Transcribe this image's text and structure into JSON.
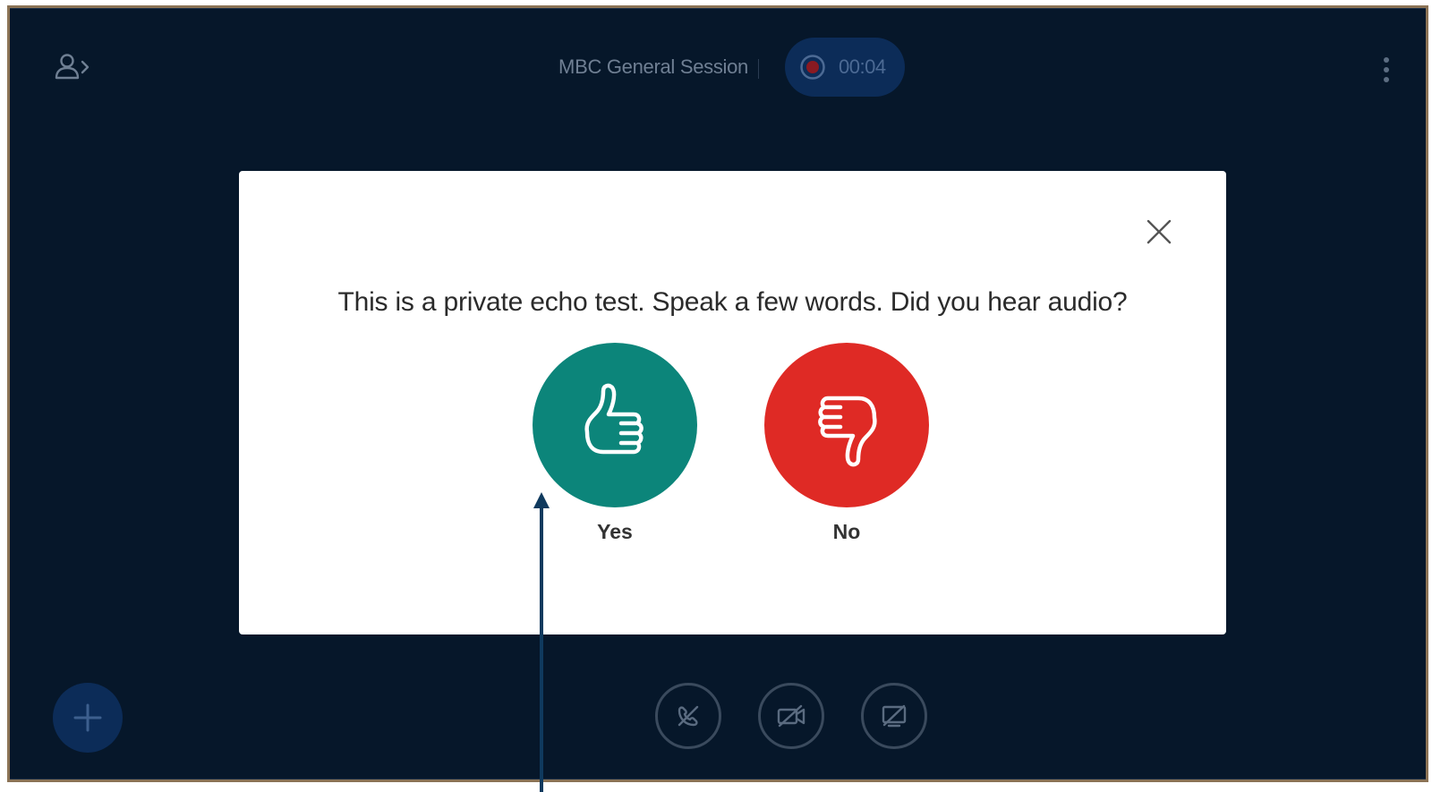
{
  "header": {
    "session_title": "MBC General Session",
    "recording_time": "00:04",
    "user_list_icon": "user-list-toggle-icon",
    "options_icon": "vertical-dots-icon"
  },
  "echo_test_modal": {
    "message": "This is a private echo test. Speak a few words. Did you hear audio?",
    "close_icon": "close-icon",
    "yes_label": "Yes",
    "no_label": "No",
    "yes_icon": "thumbs-up-icon",
    "no_icon": "thumbs-down-icon"
  },
  "footer": {
    "actions_icon": "plus-icon",
    "controls": [
      "leave-audio-icon",
      "join-video-icon",
      "screen-share-icon"
    ]
  },
  "colors": {
    "background": "#06172a",
    "frame_border": "#8b7355",
    "yes_button": "#0c857a",
    "no_button": "#df2a25",
    "accent_dark_blue": "#0c2c58",
    "annotation_arrow": "#0f3a5e"
  }
}
